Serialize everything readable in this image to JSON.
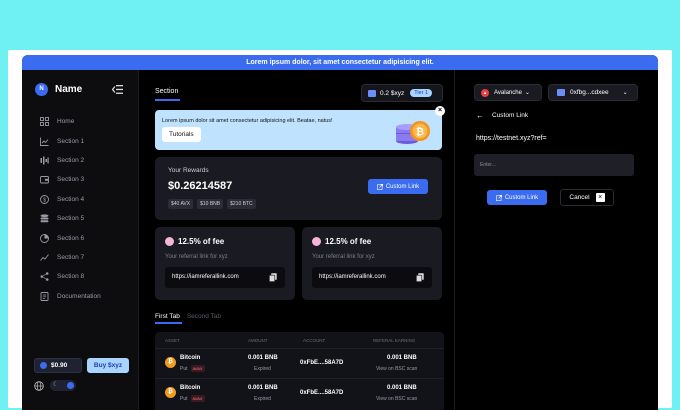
{
  "banner": "Lorem ipsum dolor, sit amet consectetur adipisicing elit.",
  "sidebar": {
    "logo_letter": "N",
    "brand": "Name",
    "items": [
      {
        "label": "Home",
        "icon": "grid-icon"
      },
      {
        "label": "Section 1",
        "icon": "chart-icon"
      },
      {
        "label": "Section 2",
        "icon": "activity-icon"
      },
      {
        "label": "Section 3",
        "icon": "wallet-icon"
      },
      {
        "label": "Section 4",
        "icon": "dollar-icon"
      },
      {
        "label": "Section 5",
        "icon": "database-icon"
      },
      {
        "label": "Section 6",
        "icon": "pie-chart-icon"
      },
      {
        "label": "Section 7",
        "icon": "line-chart-icon"
      },
      {
        "label": "Section 8",
        "icon": "share-icon"
      },
      {
        "label": "Documentation",
        "icon": "document-icon"
      }
    ],
    "balance": "$0.90",
    "buy_label": "Buy $xyz"
  },
  "main": {
    "section_tab": "Section",
    "wallet_amount": "0.2 $xyz",
    "tier": "Tier 1",
    "promo_text": "Lorem ipsum dolor sit amet consectetur adipisicing elit. Beatae, natus!",
    "tutorials_label": "Tutorials",
    "close_glyph": "×",
    "rewards": {
      "title": "Your Rewards",
      "value": "$0.26214587",
      "chips": [
        "$40 AVX",
        "$10 BNB",
        "$210 BTC"
      ],
      "custom_link_label": "Custom Link"
    },
    "fee_cards": [
      {
        "title": "12.5% of fee",
        "subtitle": "Your referral link for xyz",
        "link": "https://iamreferallink.com"
      },
      {
        "title": "12.5% of fee",
        "subtitle": "Your referral link for xyz",
        "link": "https://iamreferallink.com"
      }
    ],
    "tabs": {
      "first": "First Tab",
      "second": "Second Tab"
    },
    "table": {
      "headers": [
        "ASSET",
        "AMOUNT",
        "ACCOUNT",
        "REFERAL EARNING"
      ],
      "rows": [
        {
          "coin_symbol": "₿",
          "asset": "Bitcoin",
          "type": "Put",
          "badge": "AVAX",
          "amount": "0.001 BNB",
          "status": "Expired",
          "account": "0xFbE....58A7D",
          "earning": "0.001 BNB",
          "link": "View on BSC scan"
        },
        {
          "coin_symbol": "₿",
          "asset": "Bitcoin",
          "type": "Put",
          "badge": "AVAX",
          "amount": "0.001 BNB",
          "status": "Expired",
          "account": "0xFbE....58A7D",
          "earning": "0.001 BNB",
          "link": "View on BSC scan"
        }
      ]
    }
  },
  "right_panel": {
    "network": "Avalanche",
    "address": "0xfbg...cdxee",
    "back_label": "Custom Link",
    "ref_url": "https://testnet.xyz?ref=",
    "input_placeholder": "Enter...",
    "custom_link_label": "Custom Link",
    "cancel_label": "Cancel",
    "cancel_glyph": "×"
  },
  "colors": {
    "accent": "#3b6cf0",
    "page_background": "#6ff0f2",
    "panel": "#1a1b22"
  }
}
